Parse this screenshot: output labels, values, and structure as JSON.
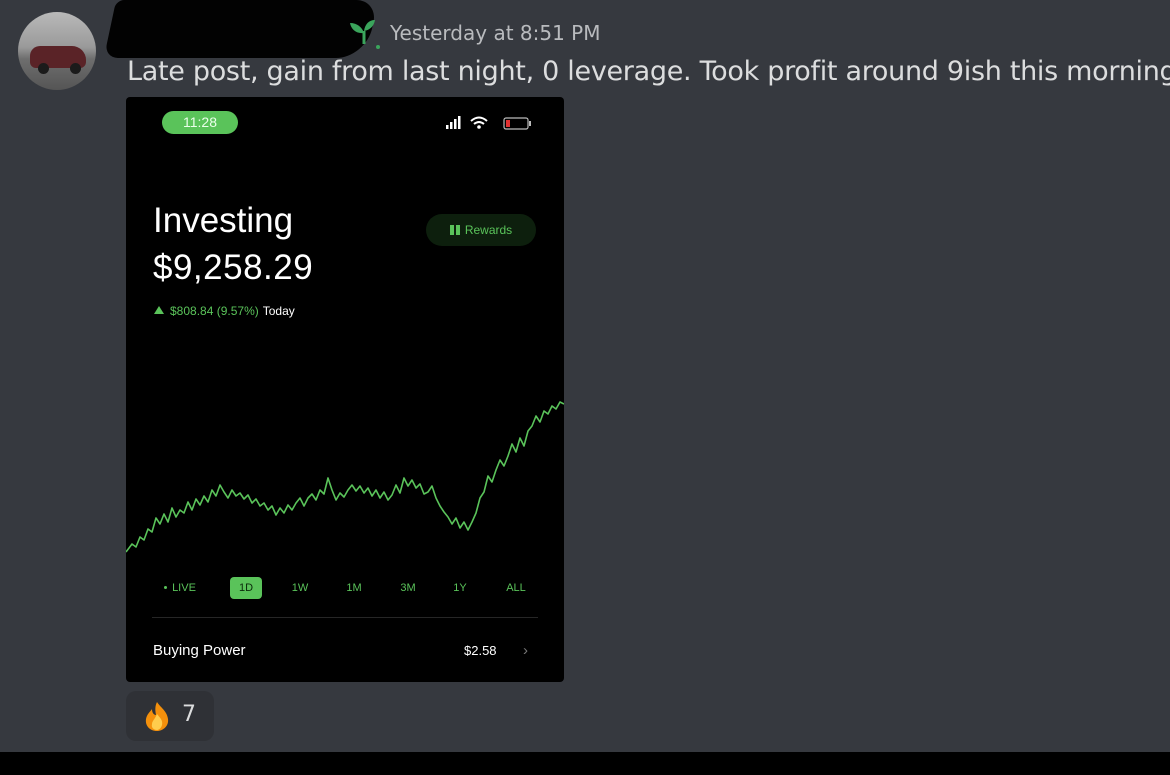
{
  "message": {
    "timestamp": "Yesterday at 8:51 PM",
    "text": "Late post, gain from last night, 0 leverage. Took profit around 9ish this morning",
    "author_badge_icon": "sprout-icon"
  },
  "phone": {
    "status_time": "11:28",
    "title": "Investing",
    "balance": "$9,258.29",
    "change_amount": "$808.84 (9.57%)",
    "change_period": "Today",
    "rewards_label": "Rewards",
    "ranges": [
      "LIVE",
      "1D",
      "1W",
      "1M",
      "3M",
      "1Y",
      "ALL"
    ],
    "active_range": "1D",
    "buying_power_label": "Buying Power",
    "buying_power_value": "$2.58",
    "accent_color": "#5ac35a"
  },
  "reaction": {
    "emoji": "fire-icon",
    "count": "7"
  }
}
